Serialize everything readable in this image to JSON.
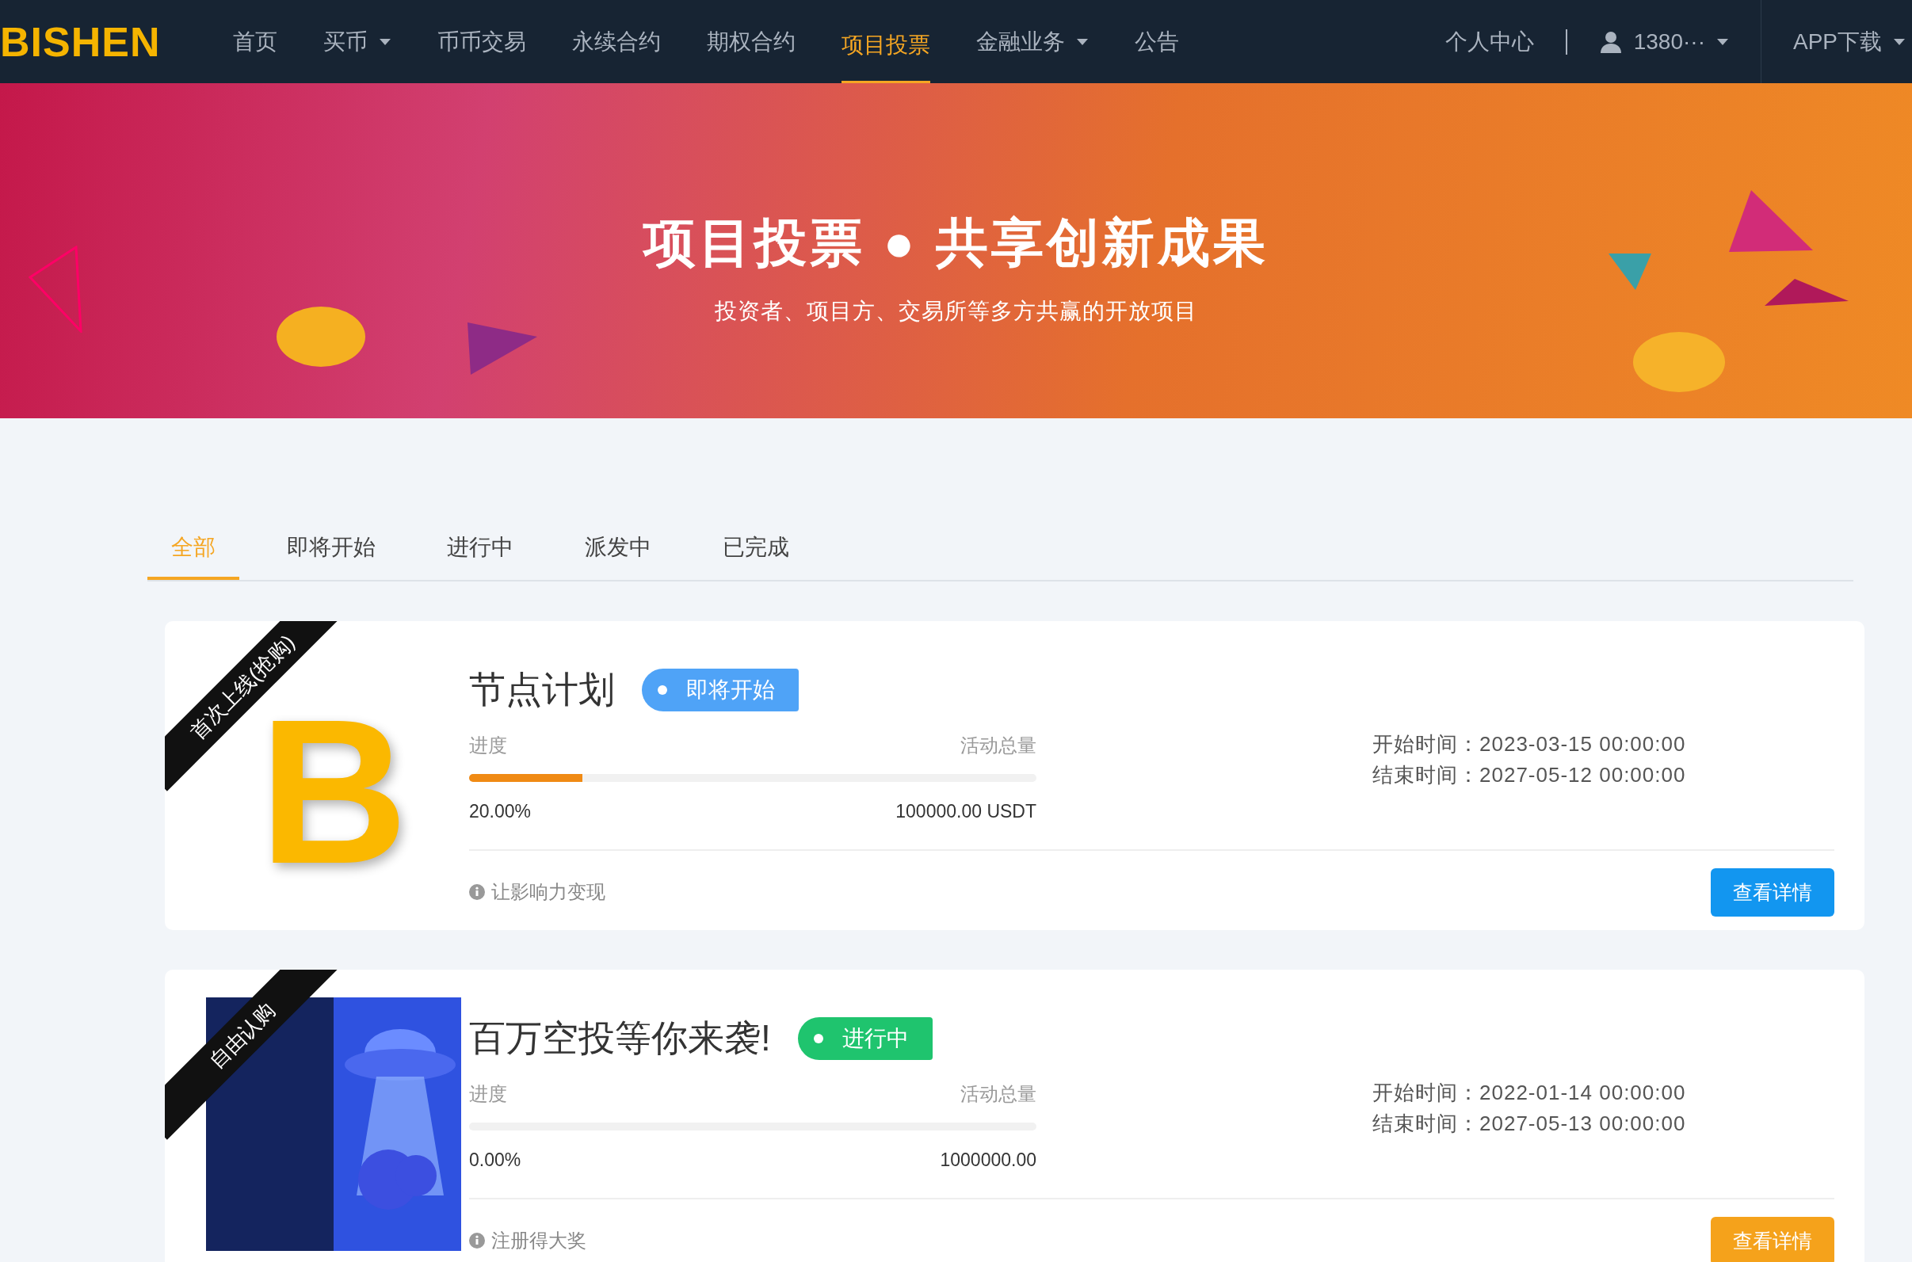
{
  "brand": "BISHEN",
  "nav": [
    {
      "label": "首页",
      "selected": false,
      "dropdown": false
    },
    {
      "label": "买币",
      "selected": false,
      "dropdown": true
    },
    {
      "label": "币币交易",
      "selected": false,
      "dropdown": false
    },
    {
      "label": "永续合约",
      "selected": false,
      "dropdown": false
    },
    {
      "label": "期权合约",
      "selected": false,
      "dropdown": false
    },
    {
      "label": "项目投票",
      "selected": true,
      "dropdown": false
    },
    {
      "label": "金融业务",
      "selected": false,
      "dropdown": true
    },
    {
      "label": "公告",
      "selected": false,
      "dropdown": false
    }
  ],
  "user_nav": {
    "center": "个人中心",
    "account": "1380···",
    "app": "APP下载"
  },
  "banner": {
    "title": "项目投票 ● 共享创新成果",
    "subtitle": "投资者、项目方、交易所等多方共赢的开放项目"
  },
  "tabs": [
    {
      "label": "全部",
      "selected": true
    },
    {
      "label": "即将开始",
      "selected": false
    },
    {
      "label": "进行中",
      "selected": false
    },
    {
      "label": "派发中",
      "selected": false
    },
    {
      "label": "已完成",
      "selected": false
    }
  ],
  "projects": [
    {
      "ribbon": "首次上线(抢购)",
      "kind": "logo",
      "logo_text": "B",
      "title": "节点计划",
      "status": {
        "kind": "upcoming",
        "label": "即将开始"
      },
      "progress_label": "进度",
      "total_label": "活动总量",
      "level": 0.2,
      "percent": "20.00%",
      "total": "100000.00 USDT",
      "start": "开始时间：2023-03-15 00:00:00",
      "end": "结束时间：2027-05-12 00:00:00",
      "note": "让影响力变现",
      "button": "查看详情"
    },
    {
      "ribbon": "自由认购",
      "kind": "banner",
      "title": "百万空投等你来袭!",
      "status": {
        "kind": "ongoing",
        "label": "进行中"
      },
      "progress_label": "进度",
      "total_label": "活动总量",
      "level": 0,
      "percent": "0.00%",
      "total": "1000000.00",
      "start": "开始时间：2022-01-14 00:00:00",
      "end": "结束时间：2027-05-13 00:00:00",
      "note": "注册得大奖",
      "button": "查看详情"
    }
  ]
}
